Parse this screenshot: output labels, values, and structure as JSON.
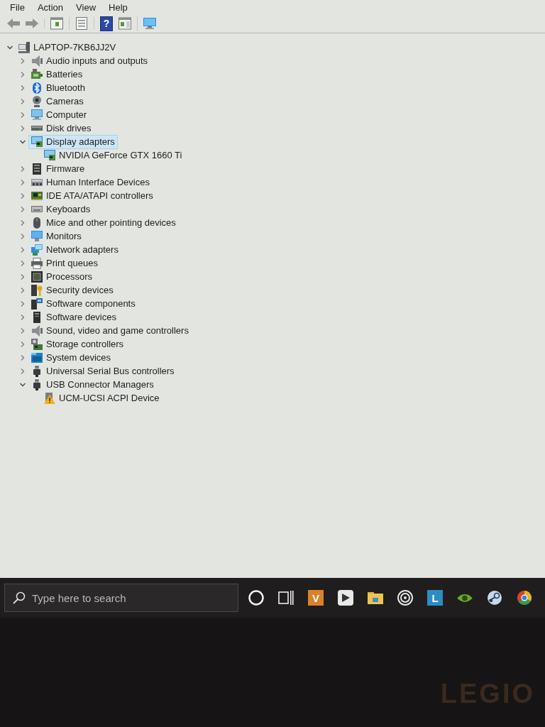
{
  "menu": [
    {
      "label": "File"
    },
    {
      "label": "Action"
    },
    {
      "label": "View"
    },
    {
      "label": "Help"
    }
  ],
  "toolbar": {
    "groups": [
      [
        {
          "kind": "back",
          "disabled": true
        },
        {
          "kind": "forward",
          "disabled": true
        }
      ],
      [
        {
          "kind": "console-tree",
          "disabled": false
        }
      ],
      [
        {
          "kind": "properties",
          "disabled": false
        }
      ],
      [
        {
          "kind": "help",
          "label": "?",
          "disabled": false
        },
        {
          "kind": "action-pane",
          "disabled": false
        }
      ],
      [
        {
          "kind": "scan",
          "disabled": false
        }
      ]
    ]
  },
  "tree": {
    "label": "LAPTOP-7KB6JJ2V",
    "kind": "laptop",
    "expanded": true,
    "selected": false,
    "children": [
      {
        "label": "Audio inputs and outputs",
        "kind": "audio",
        "expanded": false,
        "selected": false
      },
      {
        "label": "Batteries",
        "kind": "battery",
        "expanded": false,
        "selected": false
      },
      {
        "label": "Bluetooth",
        "kind": "bluetooth",
        "expanded": false,
        "selected": false
      },
      {
        "label": "Cameras",
        "kind": "camera",
        "expanded": false,
        "selected": false
      },
      {
        "label": "Computer",
        "kind": "computer",
        "expanded": false,
        "selected": false
      },
      {
        "label": "Disk drives",
        "kind": "disk",
        "expanded": false,
        "selected": false
      },
      {
        "label": "Display adapters",
        "kind": "display",
        "expanded": true,
        "selected": true,
        "children": [
          {
            "label": "NVIDIA GeForce GTX 1660 Ti",
            "kind": "display",
            "selected": false
          }
        ]
      },
      {
        "label": "Firmware",
        "kind": "firmware",
        "expanded": false,
        "selected": false
      },
      {
        "label": "Human Interface Devices",
        "kind": "hid",
        "expanded": false,
        "selected": false
      },
      {
        "label": "IDE ATA/ATAPI controllers",
        "kind": "ide",
        "expanded": false,
        "selected": false
      },
      {
        "label": "Keyboards",
        "kind": "keyboard",
        "expanded": false,
        "selected": false
      },
      {
        "label": "Mice and other pointing devices",
        "kind": "mouse",
        "expanded": false,
        "selected": false
      },
      {
        "label": "Monitors",
        "kind": "monitor",
        "expanded": false,
        "selected": false
      },
      {
        "label": "Network adapters",
        "kind": "network",
        "expanded": false,
        "selected": false
      },
      {
        "label": "Print queues",
        "kind": "printer",
        "expanded": false,
        "selected": false
      },
      {
        "label": "Processors",
        "kind": "processor",
        "expanded": false,
        "selected": false
      },
      {
        "label": "Security devices",
        "kind": "security",
        "expanded": false,
        "selected": false
      },
      {
        "label": "Software components",
        "kind": "software-component",
        "expanded": false,
        "selected": false
      },
      {
        "label": "Software devices",
        "kind": "software-device",
        "expanded": false,
        "selected": false
      },
      {
        "label": "Sound, video and game controllers",
        "kind": "audio",
        "expanded": false,
        "selected": false
      },
      {
        "label": "Storage controllers",
        "kind": "storage",
        "expanded": false,
        "selected": false
      },
      {
        "label": "System devices",
        "kind": "system",
        "expanded": false,
        "selected": false
      },
      {
        "label": "Universal Serial Bus controllers",
        "kind": "usb",
        "expanded": false,
        "selected": false
      },
      {
        "label": "USB Connector Managers",
        "kind": "usb",
        "expanded": true,
        "selected": false,
        "children": [
          {
            "label": "UCM-UCSI ACPI Device",
            "kind": "warning",
            "selected": false
          }
        ]
      }
    ]
  },
  "taskbar": {
    "search": {
      "placeholder": "Type here to search"
    },
    "items": [
      {
        "kind": "cortana"
      },
      {
        "kind": "task-view"
      },
      {
        "kind": "tile",
        "label": "V",
        "color": "#d9822b"
      },
      {
        "kind": "play"
      },
      {
        "kind": "folder"
      },
      {
        "kind": "swirl"
      },
      {
        "kind": "tile",
        "label": "L",
        "color": "#2a8fc4"
      },
      {
        "kind": "eye"
      },
      {
        "kind": "steam"
      },
      {
        "kind": "wheel"
      }
    ]
  },
  "bezel": {
    "logo": "LEGIO"
  }
}
